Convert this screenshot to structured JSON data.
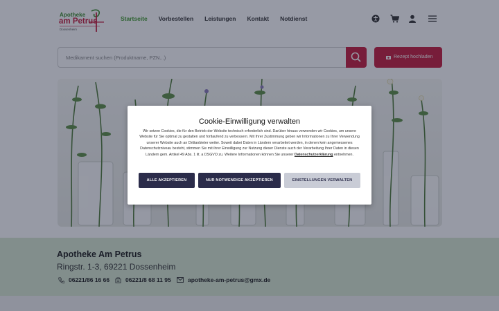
{
  "logo": {
    "line1": "Apotheke",
    "line2": "am Petrus",
    "line3": "Dossenheim"
  },
  "nav": {
    "items": [
      "Startseite",
      "Vorbestellen",
      "Leistungen",
      "Kontakt",
      "Notdienst"
    ]
  },
  "search": {
    "placeholder": "Medikament suchen (Produktname, PZN...)"
  },
  "rezept_button": "Rezept hochladen",
  "cookie": {
    "title": "Cookie-Einwilligung verwalten",
    "text_before": "Wir setzen Cookies, die für den Betrieb der Website technisch erforderlich sind. Darüber hinaus verwenden wir Cookies, um unsere Website für Sie optimal zu gestalten und fortlaufend zu verbessern. Mit Ihrer Zustimmung geben wir Informationen zu Ihrer Verwendung unserer Website auch an Drittanbieter weiter. Soweit dabei Daten in Ländern verarbeitet werden, in denen kein angemessenes Datenschutzniveau besteht, stimmen Sie mit ihrer Einwilligung zur Nutzung dieser Dienste auch der Verarbeitung Ihrer Daten in diesen Ländern gem. Artikel 49 Abs. 1 lit. a DSGVO zu. Weitere Informationen können Sie unserer ",
    "link": "Datenschutzerklärung",
    "text_after": " entnehmen.",
    "buttons": {
      "accept_all": "ALLE AKZEPTIEREN",
      "necessary": "NUR NOTWENDIGE AKZEPTIEREN",
      "settings": "EINSTELLUNGEN VERWALTEN"
    }
  },
  "footer": {
    "name": "Apotheke Am Petrus",
    "address": "Ringstr. 1-3, 69221 Dossenheim",
    "phone": "06221/86 16 66",
    "fax": "06221/8 68 11 95",
    "email": "apotheke-am-petrus@gmx.de"
  },
  "colors": {
    "brand_red": "#c51d3c",
    "brand_green": "#3f9a2c",
    "info_bg": "#d9ead1",
    "modal_button_dark": "#2b2c4a"
  },
  "icons": [
    "accessibility-icon",
    "cart-icon",
    "user-icon",
    "menu-icon",
    "search-icon",
    "upload-icon",
    "phone-icon",
    "fax-icon",
    "mail-icon"
  ]
}
